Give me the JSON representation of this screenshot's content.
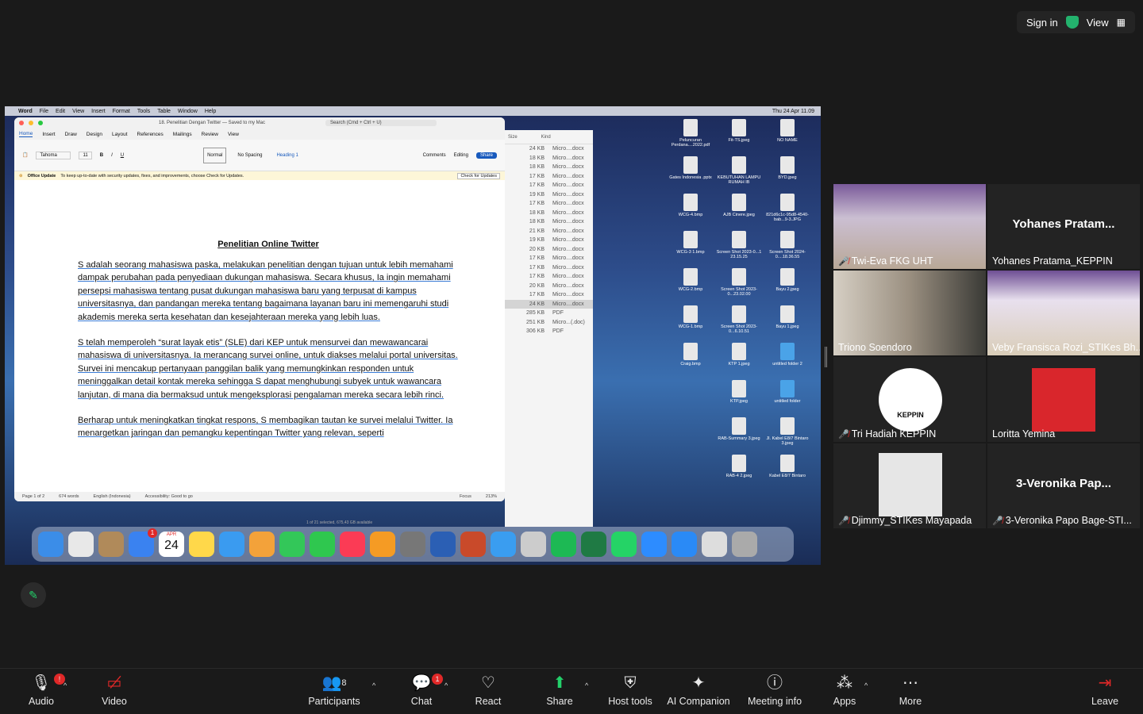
{
  "top_bar": {
    "sign_in": "Sign in",
    "view": "View"
  },
  "shared_screen": {
    "mac_menu": [
      "Word",
      "File",
      "Edit",
      "View",
      "Insert",
      "Format",
      "Tools",
      "Table",
      "Window",
      "Help"
    ],
    "clock": "Thu 24 Apr 11.09",
    "word": {
      "doc_title_bar": "18. Penelitian Dengan Twitter — Saved to my Mac",
      "search_placeholder": "Search (Cmd + Ctrl + U)",
      "tabs": [
        "Home",
        "Insert",
        "Draw",
        "Design",
        "Layout",
        "References",
        "Mailings",
        "Review",
        "View"
      ],
      "comments": "Comments",
      "editing": "Editing",
      "share": "Share",
      "font": "Tahoma",
      "font_size": "11",
      "styles": [
        "Normal",
        "No Spacing",
        "Heading 1"
      ],
      "update_label": "Office Update",
      "update_text": "To keep up-to-date with security updates, fixes, and improvements, choose Check for Updates.",
      "update_button": "Check for Updates",
      "doc_heading": "Penelitian Online Twitter",
      "paragraphs": [
        "S adalah seorang mahasiswa paska, melakukan penelitian dengan tujuan untuk lebih memahami dampak perubahan pada penyediaan dukungan mahasiswa. Secara khusus, Ia ingin memahami persepsi mahasiswa tentang pusat dukungan mahasiswa baru yang terpusat di kampus universitasnya, dan pandangan mereka tentang bagaimana layanan baru ini memengaruhi studi akademis mereka serta kesehatan dan kesejahteraan mereka yang lebih luas.",
        "S telah memperoleh “surat layak etis” (SLE) dari KEP untuk mensurvei dan mewawancarai mahasiswa di universitasnya. Ia merancang survei online, untuk diakses melalui portal universitas. Survei ini mencakup pertanyaan panggilan balik yang memungkinkan responden untuk meninggalkan detail kontak mereka sehingga S dapat menghubungi subyek untuk wawancara lanjutan, di mana dia bermaksud untuk mengeksplorasi pengalaman mereka secara lebih rinci.",
        "Berharap untuk meningkatkan tingkat respons, S membagikan tautan ke survei melalui Twitter. Ia menargetkan jaringan dan pemangku kepentingan Twitter yang relevan, seperti"
      ],
      "status": [
        "Page 1 of 2",
        "674 words",
        "English (Indonesia)",
        "Accessibility: Good to go",
        "Focus",
        "213%"
      ]
    },
    "finder_rows": [
      [
        "24 KB",
        "Micro....docx"
      ],
      [
        "18 KB",
        "Micro....docx"
      ],
      [
        "18 KB",
        "Micro....docx"
      ],
      [
        "17 KB",
        "Micro....docx"
      ],
      [
        "17 KB",
        "Micro....docx"
      ],
      [
        "19 KB",
        "Micro....docx"
      ],
      [
        "17 KB",
        "Micro....docx"
      ],
      [
        "18 KB",
        "Micro....docx"
      ],
      [
        "18 KB",
        "Micro....docx"
      ],
      [
        "21 KB",
        "Micro....docx"
      ],
      [
        "19 KB",
        "Micro....docx"
      ],
      [
        "20 KB",
        "Micro....docx"
      ],
      [
        "17 KB",
        "Micro....docx"
      ],
      [
        "17 KB",
        "Micro....docx"
      ],
      [
        "17 KB",
        "Micro....docx"
      ],
      [
        "20 KB",
        "Micro....docx"
      ],
      [
        "17 KB",
        "Micro....docx"
      ],
      [
        "24 KB",
        "Micro....docx"
      ],
      [
        "285 KB",
        "PDF"
      ],
      [
        "251 KB",
        "Micro...(.doc)"
      ],
      [
        "306 KB",
        "PDF"
      ]
    ],
    "finder_header": [
      "Size",
      "Kind"
    ],
    "finder_status": "1 of 21 selected, 675,43 GB available",
    "desktop_icons": [
      "Peluncuran Perdana....2022.pdf",
      "Fit-TS.jpeg",
      "NO NAME",
      "Gates Indonesia .pptx",
      "KEBUTUHAN LAMPU RUMAH IB",
      "BYD.jpeg",
      "WCG-4.bmp",
      "AJB Cinere.jpeg",
      "821d6c1c-95d8-4540-bab...9-3.JPG",
      "WCG-3 1.bmp",
      "Screen Shot 2023-0...1 23.15.25",
      "Screen Shot 2024-0....18.36.55",
      "WCG-2.bmp",
      "Screen Shot 2023-0...23.02.00",
      "Bayu 2.jpeg",
      "WCG-1.bmp",
      "Screen Shot 2023-0...6.10.51",
      "Bayu 1.jpeg",
      "Craig.bmp",
      "KTP 1.jpeg",
      "untitled folder 2",
      "",
      "KTP.jpeg",
      "untitled folder",
      "",
      "RAB-Summary 3.jpeg",
      "Jl. Kabel E8/7 Bintaro 3.jpeg",
      "",
      "RAB-4 2.jpeg",
      "Kabel E8/7 Bintaro"
    ],
    "dock_badges": {
      "mail": "1",
      "calendar_month": "APR",
      "calendar_day": "24"
    }
  },
  "participants": [
    {
      "name": "Twi-Eva FKG UHT",
      "muted": true,
      "video": true
    },
    {
      "name": "Yohanes Pratama_KEPPIN",
      "display": "Yohanes  Pratam...",
      "muted": false,
      "video": false
    },
    {
      "name": "Triono Soendoro",
      "muted": false,
      "video": true,
      "talking": true
    },
    {
      "name": "Veby Fransisca Rozi_STIKes Bh...",
      "muted": false,
      "video": true
    },
    {
      "name": "Tri Hadiah KEPPIN",
      "muted": true,
      "video": false,
      "avatar": "KEPPIN"
    },
    {
      "name": "Loritta Yemina",
      "muted": false,
      "video": false
    },
    {
      "name": "Djimmy_STIKes Mayapada",
      "muted": true,
      "video": false
    },
    {
      "name": "3-Veronika Papo Bage-STI...",
      "display": "3-Veronika  Pap...",
      "muted": true,
      "video": false
    }
  ],
  "toolbar": {
    "audio": "Audio",
    "audio_badge": "!",
    "video": "Video",
    "participants": "Participants",
    "participant_count": "8",
    "chat": "Chat",
    "chat_badge": "1",
    "react": "React",
    "share": "Share",
    "host_tools": "Host tools",
    "ai_companion": "AI Companion",
    "meeting_info": "Meeting info",
    "apps": "Apps",
    "more": "More",
    "leave": "Leave"
  },
  "colors": {
    "accent_green": "#23d06a",
    "alert_red": "#e02828",
    "word_blue": "#185abd"
  }
}
